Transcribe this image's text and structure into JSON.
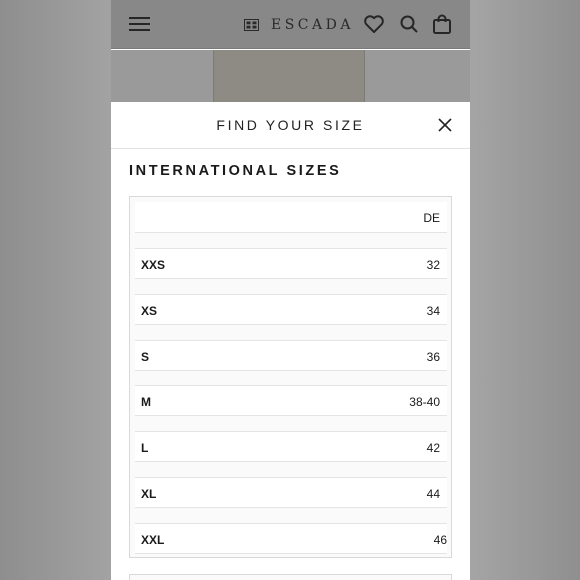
{
  "header": {
    "brand_name": "ESCADA"
  },
  "modal": {
    "title": "FIND YOUR SIZE",
    "section_title": "INTERNATIONAL SIZES",
    "table": {
      "column_header": "DE",
      "rows": [
        {
          "size": "XXS",
          "de": "32"
        },
        {
          "size": "XS",
          "de": "34"
        },
        {
          "size": "S",
          "de": "36"
        },
        {
          "size": "M",
          "de": "38-40"
        },
        {
          "size": "L",
          "de": "42"
        },
        {
          "size": "XL",
          "de": "44"
        },
        {
          "size": "XXL",
          "de": "46"
        }
      ]
    }
  },
  "icons": {
    "menu": "hamburger-menu-icon",
    "wishlist": "heart-icon",
    "search": "search-icon",
    "cart": "shopping-bag-icon",
    "close": "close-icon"
  },
  "colors": {
    "text": "#1a1a1a",
    "header_dim": "#888888",
    "border": "#d9d9d9"
  }
}
